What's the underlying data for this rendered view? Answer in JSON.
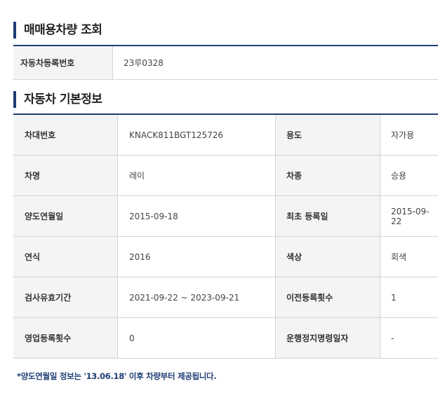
{
  "search_section": {
    "title": "매매용차량 조회",
    "reg_number_label": "자동차등록번호",
    "reg_number_value": "23루0328"
  },
  "info_section": {
    "title": "자동차 기본정보",
    "rows": [
      {
        "label1": "차대번호",
        "value1": "KNACK811BGT125726",
        "label2": "용도",
        "value2": "자가용"
      },
      {
        "label1": "차명",
        "value1": "레이",
        "label2": "차종",
        "value2": "승용"
      },
      {
        "label1": "양도연월일",
        "value1": "2015-09-18",
        "label2": "최초 등록일",
        "value2": "2015-09-22"
      },
      {
        "label1": "연식",
        "value1": "2016",
        "label2": "색상",
        "value2": "회색"
      },
      {
        "label1": "검사유효기간",
        "value1": "2021-09-22 ~ 2023-09-21",
        "label2": "이전등록횟수",
        "value2": "1"
      },
      {
        "label1": "영업등록횟수",
        "value1": "0",
        "label2": "운행정지명령일자",
        "value2": "-"
      }
    ]
  },
  "footnote": "*양도연월일 정보는 '13.06.18' 이후 차량부터 제공됩니다."
}
